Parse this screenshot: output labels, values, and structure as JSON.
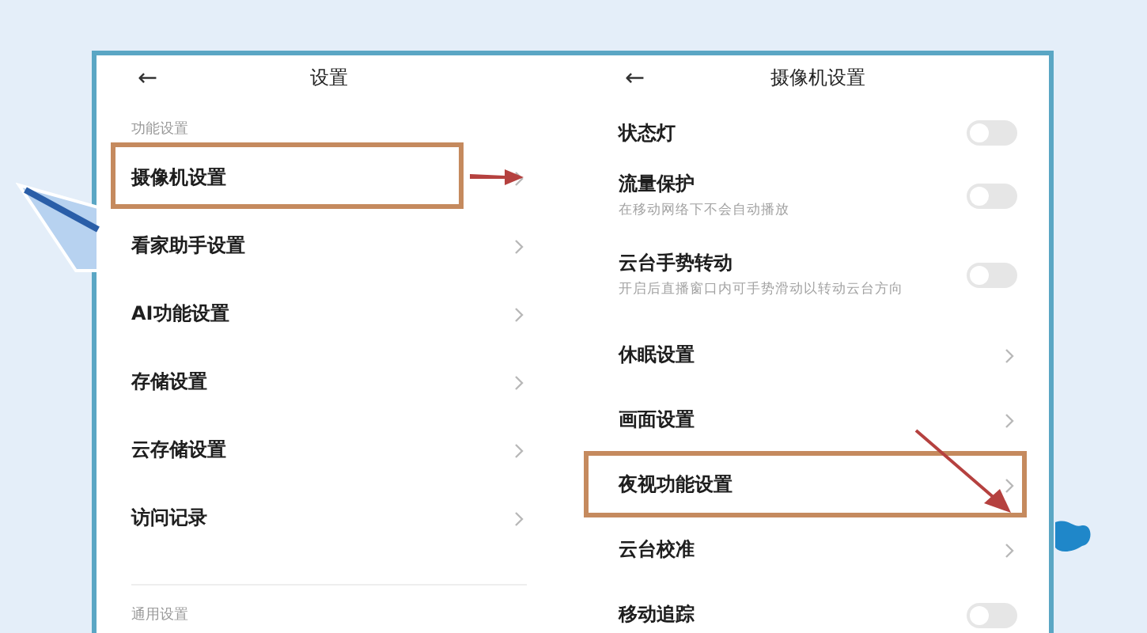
{
  "left_screen": {
    "title": "设置",
    "back_icon": "←",
    "sections": [
      {
        "header": "功能设置",
        "items": [
          {
            "label": "摄像机设置",
            "highlighted": true
          },
          {
            "label": "看家助手设置",
            "highlighted": false
          },
          {
            "label": "AI功能设置",
            "highlighted": false
          },
          {
            "label": "存储设置",
            "highlighted": false
          },
          {
            "label": "云存储设置",
            "highlighted": false
          },
          {
            "label": "访问记录",
            "highlighted": false
          }
        ]
      },
      {
        "header": "通用设置"
      }
    ]
  },
  "right_screen": {
    "title": "摄像机设置",
    "back_icon": "←",
    "items": [
      {
        "kind": "toggle",
        "label": "状态灯",
        "on": false,
        "highlighted": false
      },
      {
        "kind": "toggle",
        "label": "流量保护",
        "description": "在移动网络下不会自动播放",
        "on": false,
        "highlighted": false
      },
      {
        "kind": "toggle",
        "label": "云台手势转动",
        "description": "开启后直播窗口内可手势滑动以转动云台方向",
        "on": false,
        "highlighted": false
      },
      {
        "kind": "link",
        "label": "休眠设置",
        "highlighted": false
      },
      {
        "kind": "link",
        "label": "画面设置",
        "highlighted": false
      },
      {
        "kind": "link",
        "label": "夜视功能设置",
        "highlighted": true
      },
      {
        "kind": "link",
        "label": "云台校准",
        "highlighted": false
      },
      {
        "kind": "toggle",
        "label": "移动追踪",
        "on": false,
        "highlighted": false
      }
    ]
  }
}
